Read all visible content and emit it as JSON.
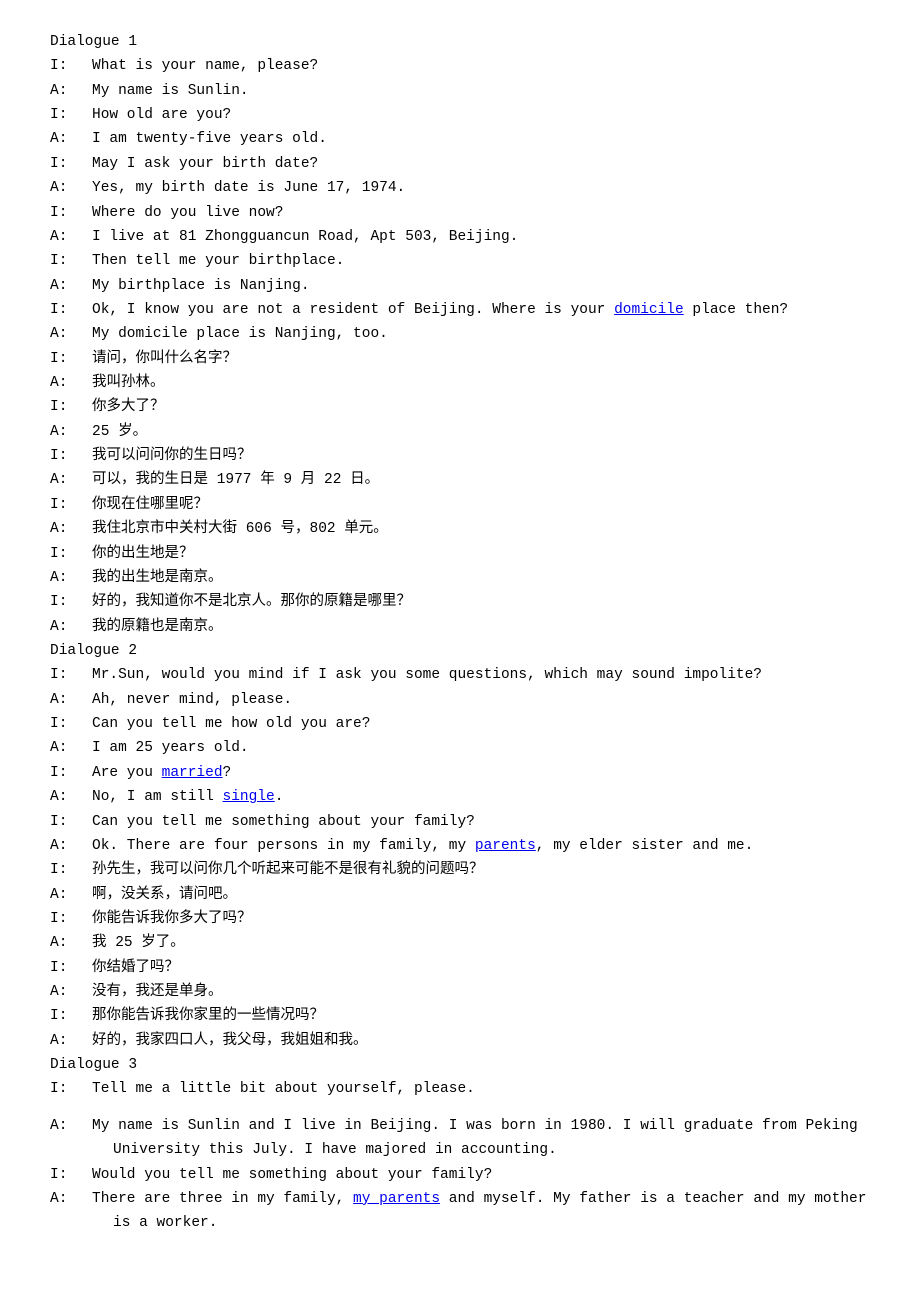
{
  "d1": {
    "title": "Dialogue 1",
    "l1s": "I:",
    "l1": "What is your name, please?",
    "l2s": "A:",
    "l2": "My name is Sunlin.",
    "l3s": "I:",
    "l3": "How old are you?",
    "l4s": "A:",
    "l4": "I am twenty-five years old.",
    "l5s": "I:",
    "l5": "May I ask your birth date?",
    "l6s": "A:",
    "l6": "Yes, my birth date is June 17, 1974.",
    "l7s": "I:",
    "l7": "Where do you live now?",
    "l8s": "A:",
    "l8": "I live at 81 Zhongguancun Road, Apt 503, Beijing.",
    "l9s": "I:",
    "l9": "Then tell me your birthplace.",
    "l10s": "A:",
    "l10": "My birthplace is Nanjing.",
    "l11s": "I:",
    "l11a": "Ok, I know you are not a resident of Beijing. Where is your ",
    "l11link": "domicile",
    "l11b": " place then?",
    "l12s": "A:",
    "l12": "My domicile place is Nanjing, too.",
    "l13s": "I:",
    "l13": "请问，你叫什么名字？",
    "l14s": "A:",
    "l14": "我叫孙林。",
    "l15s": "I:",
    "l15": "你多大了？",
    "l16s": "A:",
    "l16": "25 岁。",
    "l17s": "I:",
    "l17": "我可以问问你的生日吗？",
    "l18s": "A:",
    "l18": "可以，我的生日是 1977 年 9 月 22 日。",
    "l19s": "I:",
    "l19": "你现在住哪里呢？",
    "l20s": "A:",
    "l20": "我住北京市中关村大街 606 号，802 单元。",
    "l21s": "I:",
    "l21": "你的出生地是？",
    "l22s": "A:",
    "l22": "我的出生地是南京。",
    "l23s": "I:",
    "l23": "好的，我知道你不是北京人。那你的原籍是哪里？",
    "l24s": "A:",
    "l24": "我的原籍也是南京。"
  },
  "d2": {
    "title": "Dialogue 2",
    "l1s": "I:",
    "l1": "Mr.Sun, would you mind if I ask you some questions, which may sound impolite?",
    "l2s": "A:",
    "l2": "Ah, never mind, please.",
    "l3s": "I:",
    "l3": "Can you tell me how old you are?",
    "l4s": "A:",
    "l4": "I am 25 years old.",
    "l5s": "I:",
    "l5a": "Are you ",
    "l5link": "married",
    "l5b": "?",
    "l6s": "A:",
    "l6a": "No, I am still ",
    "l6link": "single",
    "l6b": ".",
    "l7s": "I:",
    "l7": "Can you tell me something about your family?",
    "l8s": "A:",
    "l8a": "Ok. There are four persons in my family, my ",
    "l8link": "parents",
    "l8b": ", my elder sister and me.",
    "l9s": "I:",
    "l9": "孙先生，我可以问你几个听起来可能不是很有礼貌的问题吗？",
    "l10s": "A:",
    "l10": "啊，没关系，请问吧。",
    "l11s": "I:",
    "l11": "你能告诉我你多大了吗？",
    "l12s": "A:",
    "l12": "我 25 岁了。",
    "l13s": "I:",
    "l13": "你结婚了吗？",
    "l14s": "A:",
    "l14": "没有，我还是单身。",
    "l15s": "I:",
    "l15": "那你能告诉我你家里的一些情况吗？",
    "l16s": "A:",
    "l16": "好的，我家四口人，我父母，我姐姐和我。"
  },
  "d3": {
    "title": "Dialogue 3",
    "l1s": "I:",
    "l1": "Tell me a little bit about yourself, please.",
    "l2s": "A:",
    "l2": "My name is Sunlin and I live in Beijing. I was born in 1980. I will graduate from Peking",
    "l2c": "University this July. I have majored in accounting.",
    "l3s": "I:",
    "l3": "Would you tell me something about your family?",
    "l4s": "A:",
    "l4a": "There are three in my family, ",
    "l4link": "my parents",
    "l4b": " and myself. My father is a teacher and my mother",
    "l4c": "is a worker."
  }
}
